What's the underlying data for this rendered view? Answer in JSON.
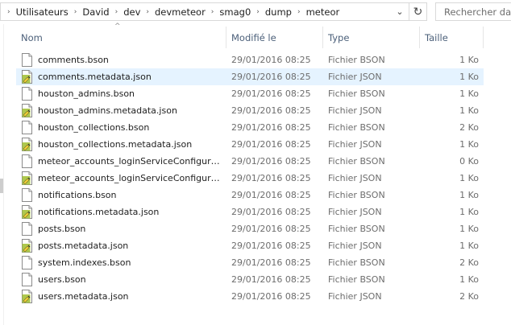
{
  "address": {
    "crumbs": [
      "Utilisateurs",
      "David",
      "dev",
      "devmeteor",
      "smag0",
      "dump",
      "meteor"
    ],
    "separator": "›",
    "dropdown": "⌄",
    "refresh": "↻"
  },
  "search": {
    "placeholder": "Rechercher dan"
  },
  "columns": {
    "name": "Nom",
    "date": "Modifié le",
    "type": "Type",
    "size": "Taille",
    "sort_glyph": "^"
  },
  "files": [
    {
      "name": "comments.bson",
      "date": "29/01/2016 08:25",
      "type": "Fichier BSON",
      "size": "1 Ko",
      "icon": "bson-file-icon"
    },
    {
      "name": "comments.metadata.json",
      "date": "29/01/2016 08:25",
      "type": "Fichier JSON",
      "size": "1 Ko",
      "icon": "json-file-icon",
      "selected": true
    },
    {
      "name": "houston_admins.bson",
      "date": "29/01/2016 08:25",
      "type": "Fichier BSON",
      "size": "1 Ko",
      "icon": "bson-file-icon"
    },
    {
      "name": "houston_admins.metadata.json",
      "date": "29/01/2016 08:25",
      "type": "Fichier JSON",
      "size": "1 Ko",
      "icon": "json-file-icon"
    },
    {
      "name": "houston_collections.bson",
      "date": "29/01/2016 08:25",
      "type": "Fichier BSON",
      "size": "2 Ko",
      "icon": "bson-file-icon"
    },
    {
      "name": "houston_collections.metadata.json",
      "date": "29/01/2016 08:25",
      "type": "Fichier JSON",
      "size": "1 Ko",
      "icon": "json-file-icon"
    },
    {
      "name": "meteor_accounts_loginServiceConfigurat...",
      "date": "29/01/2016 08:25",
      "type": "Fichier BSON",
      "size": "0 Ko",
      "icon": "bson-file-icon"
    },
    {
      "name": "meteor_accounts_loginServiceConfigurat...",
      "date": "29/01/2016 08:25",
      "type": "Fichier JSON",
      "size": "1 Ko",
      "icon": "json-file-icon"
    },
    {
      "name": "notifications.bson",
      "date": "29/01/2016 08:25",
      "type": "Fichier BSON",
      "size": "1 Ko",
      "icon": "bson-file-icon"
    },
    {
      "name": "notifications.metadata.json",
      "date": "29/01/2016 08:25",
      "type": "Fichier JSON",
      "size": "1 Ko",
      "icon": "json-file-icon"
    },
    {
      "name": "posts.bson",
      "date": "29/01/2016 08:25",
      "type": "Fichier BSON",
      "size": "1 Ko",
      "icon": "bson-file-icon"
    },
    {
      "name": "posts.metadata.json",
      "date": "29/01/2016 08:25",
      "type": "Fichier JSON",
      "size": "1 Ko",
      "icon": "json-file-icon"
    },
    {
      "name": "system.indexes.bson",
      "date": "29/01/2016 08:25",
      "type": "Fichier BSON",
      "size": "2 Ko",
      "icon": "bson-file-icon"
    },
    {
      "name": "users.bson",
      "date": "29/01/2016 08:25",
      "type": "Fichier BSON",
      "size": "1 Ko",
      "icon": "bson-file-icon"
    },
    {
      "name": "users.metadata.json",
      "date": "29/01/2016 08:25",
      "type": "Fichier JSON",
      "size": "2 Ko",
      "icon": "json-file-icon"
    }
  ],
  "colors": {
    "selection": "#e5f3ff",
    "header_text": "#4c607a",
    "json_accent": "#a5c23a"
  }
}
